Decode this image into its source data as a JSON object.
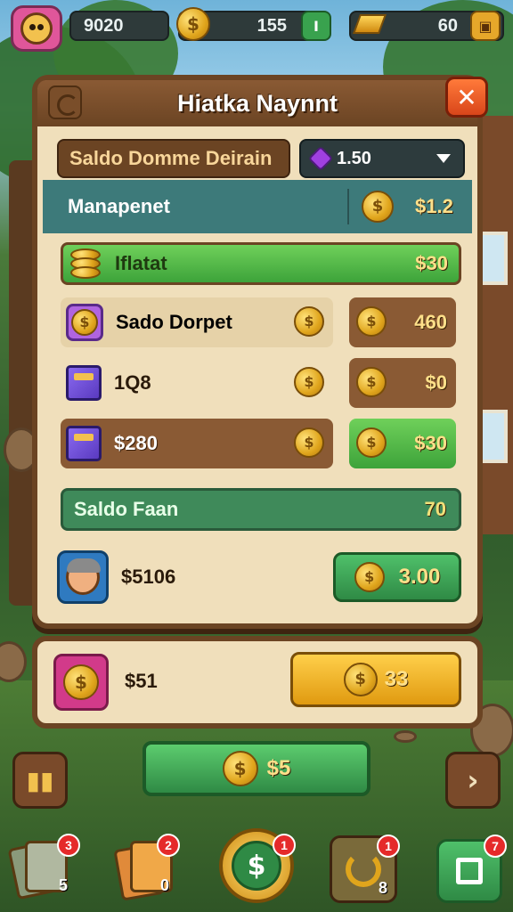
{
  "top_bar": {
    "player_score": "9020",
    "coins": "155",
    "coins_button": "I",
    "gold": "60"
  },
  "panel": {
    "title": "Hiatka Naynnt",
    "balance_label": "Saldo Domme Deirain",
    "balance_value": "1.50",
    "section_label": "Manapenet",
    "section_value": "$1.2",
    "highlight_row": {
      "label": "Iflatat",
      "value": "$30"
    },
    "items": [
      {
        "label": "Sado Dorpet",
        "price": "460"
      },
      {
        "label": "1Q8",
        "price": "$0"
      },
      {
        "label": "$280",
        "price": "$30"
      }
    ],
    "saldo_row": {
      "label": "Saldo Faan",
      "value": "70"
    },
    "reward_row": {
      "label": "$5106",
      "button": "3.00"
    }
  },
  "bottom_panel": {
    "label": "$51",
    "button": "33"
  },
  "collect_button": "$5",
  "nav": [
    {
      "badge": "3",
      "count": "5"
    },
    {
      "badge": "2",
      "count": "0"
    },
    {
      "badge": "1"
    },
    {
      "badge": "1",
      "count": "8"
    },
    {
      "badge": "7"
    }
  ],
  "colors": {
    "panel_bg": "#f0dfbb",
    "panel_border": "#6b4423",
    "accent_green": "#3da33a",
    "accent_teal": "#3d7a7a",
    "close_red": "#d9461a",
    "gold": "#e6a72a"
  }
}
